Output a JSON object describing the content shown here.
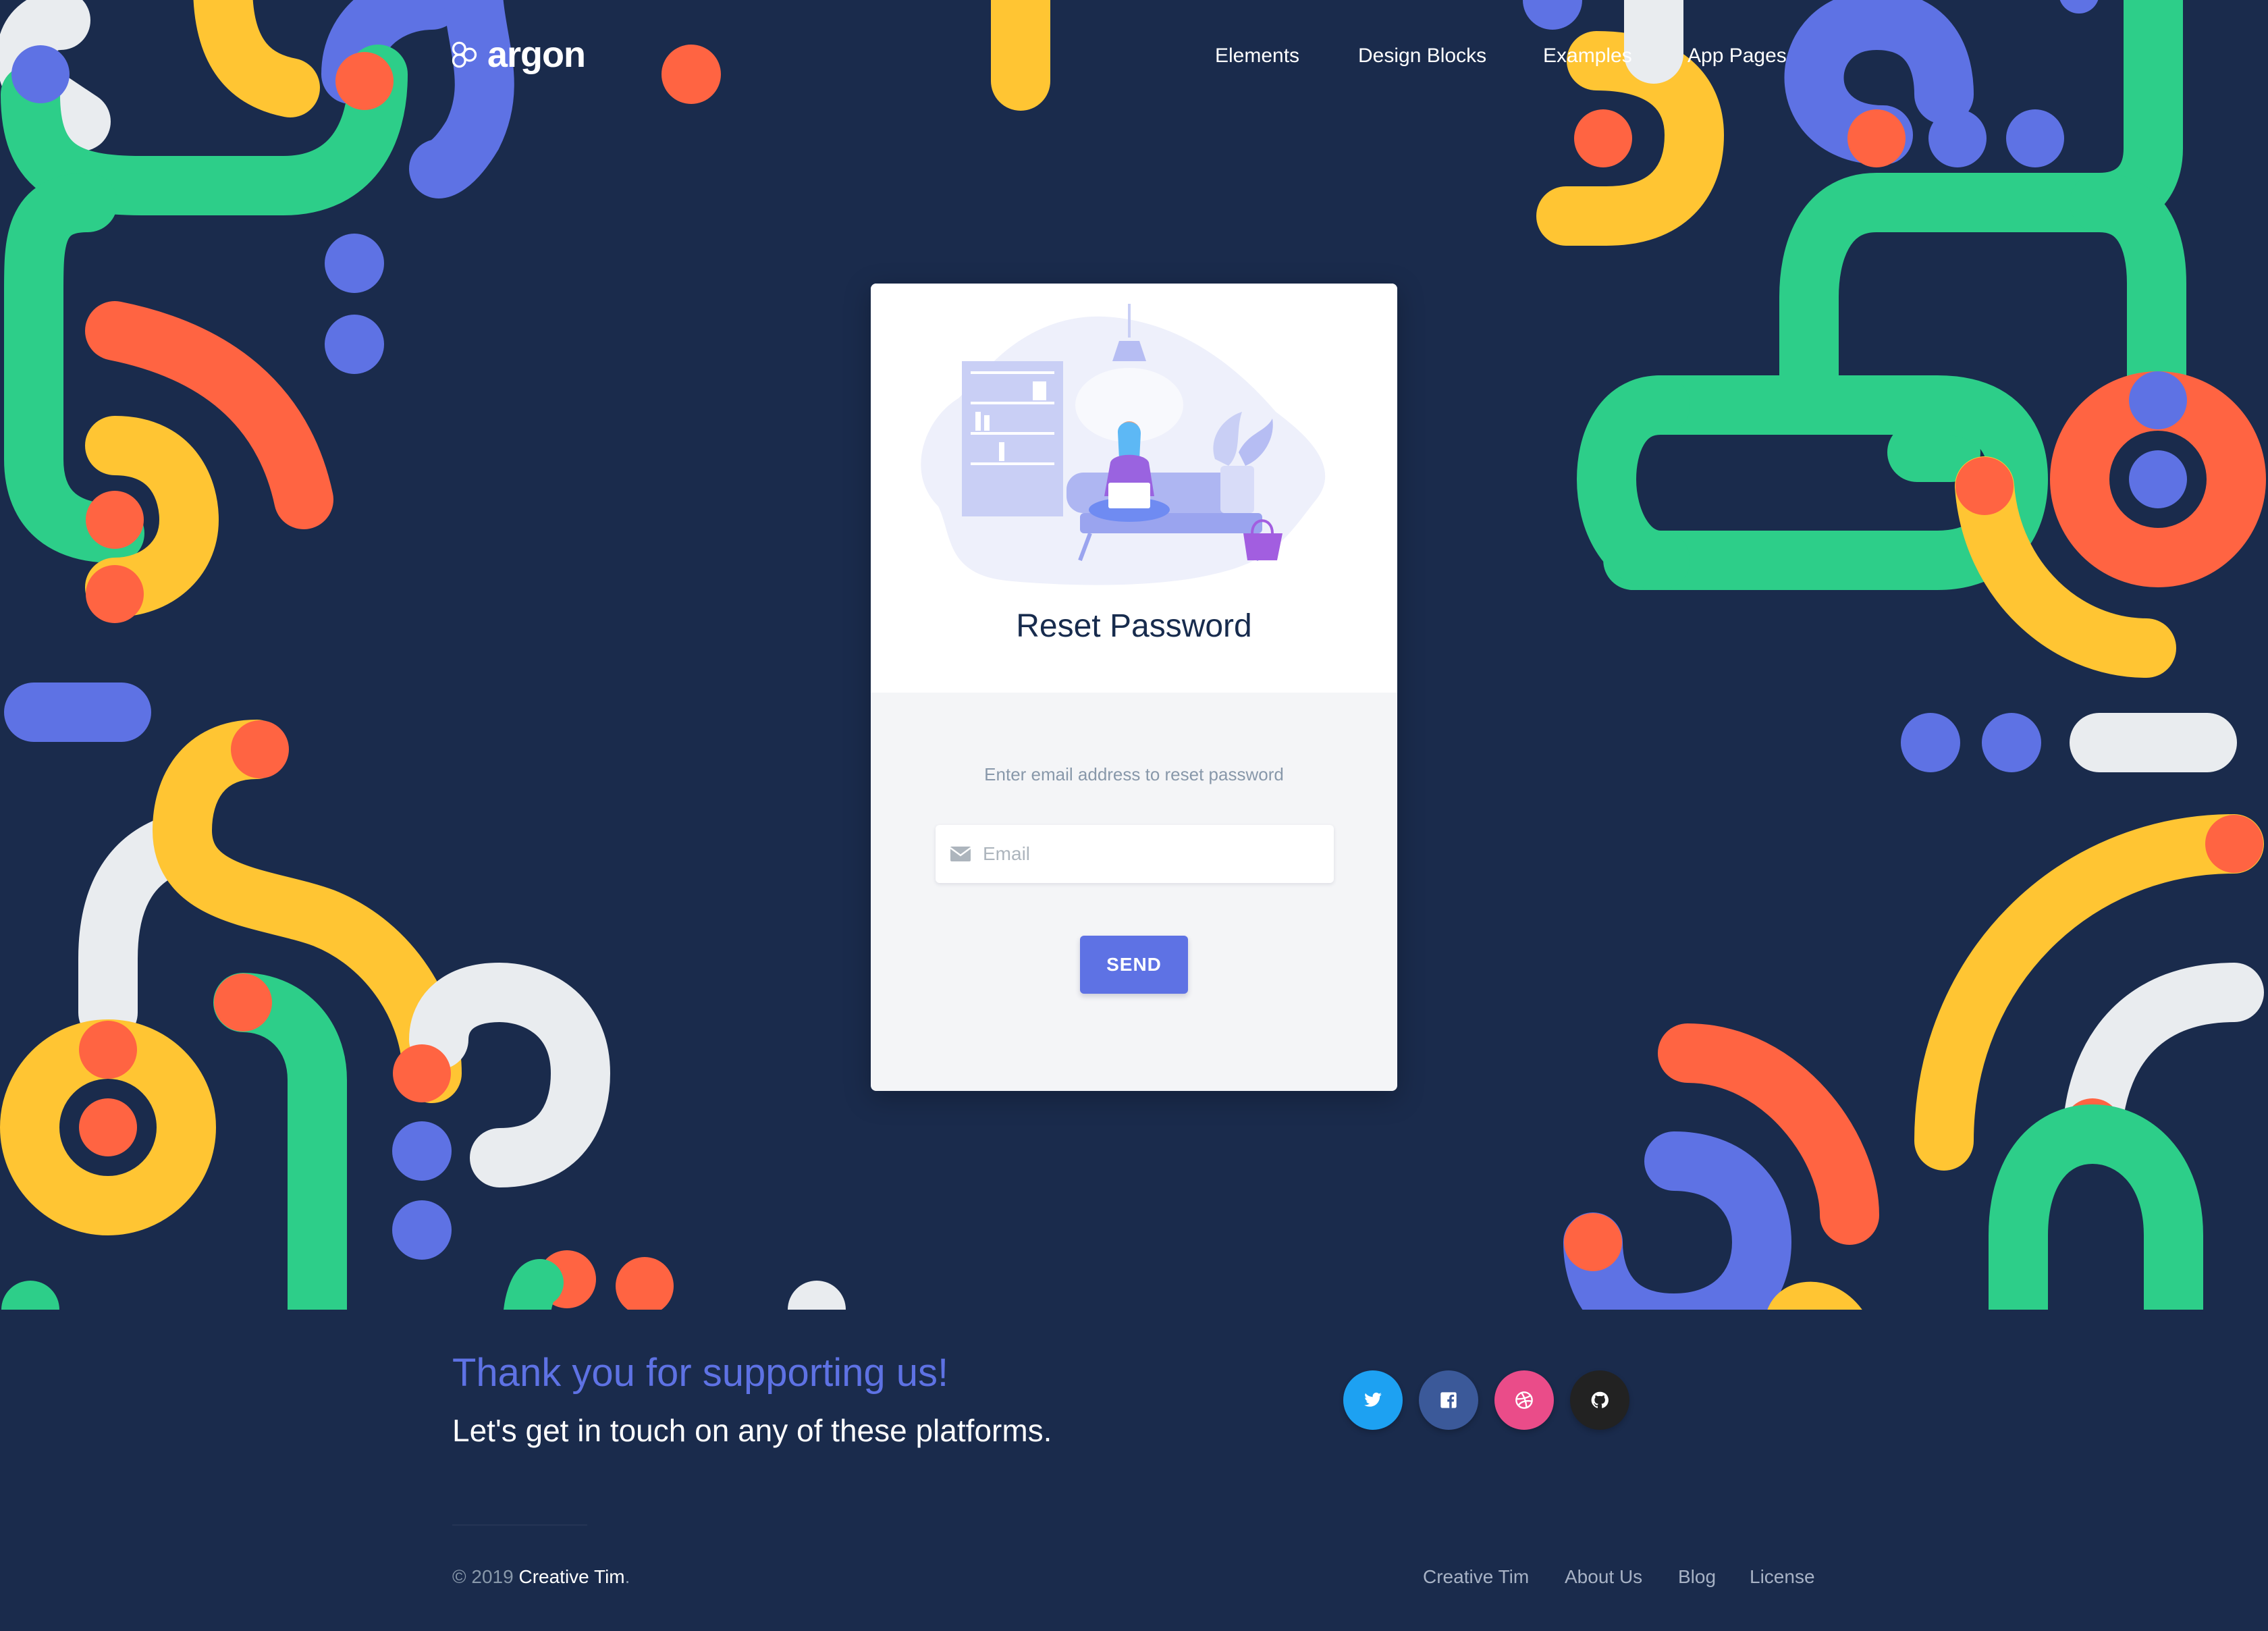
{
  "brand": {
    "name": "argon"
  },
  "nav": {
    "elements": "Elements",
    "design_blocks": "Design Blocks",
    "examples": "Examples",
    "app_pages": "App Pages"
  },
  "card": {
    "title": "Reset Password",
    "hint": "Enter email address to reset password",
    "email_placeholder": "Email",
    "send_label": "SEND"
  },
  "footer": {
    "thanks": "Thank you for supporting us!",
    "touch": "Let's get in touch on any of these platforms.",
    "socials": [
      "twitter-icon",
      "facebook-icon",
      "dribbble-icon",
      "github-icon"
    ],
    "copyright_prefix": "© 2019 ",
    "copyright_brand": "Creative Tim",
    "copyright_suffix": ".",
    "links": [
      "Creative Tim",
      "About Us",
      "Blog",
      "License"
    ]
  },
  "colors": {
    "background": "#1a2b4c",
    "accent": "#5e72e4",
    "green": "#2dce89",
    "yellow": "#ffc533",
    "orange": "#ff6442",
    "blue": "#5e72e4",
    "light": "#e9ecef"
  }
}
